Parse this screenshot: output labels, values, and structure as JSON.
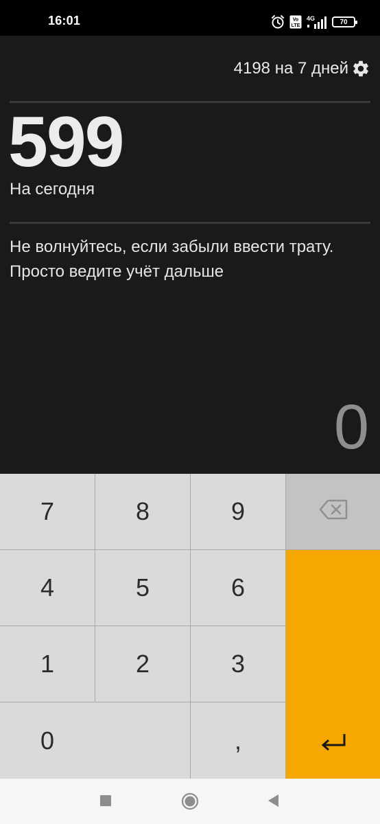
{
  "status_bar": {
    "time": "16:01",
    "icons": [
      "alarm-icon",
      "volte-icon",
      "signal-4g-icon",
      "battery-icon"
    ],
    "volte_label": "Vo LTE",
    "network_label": "4G",
    "battery_level": "70"
  },
  "header": {
    "budget_text": "4198 на 7 дней",
    "settings_icon": "gear-icon"
  },
  "today": {
    "amount": "599",
    "label": "На сегодня"
  },
  "hint": "Не волнуйтесь, если забыли ввести трату. Просто ведите учёт дальше",
  "entry": {
    "value": "0"
  },
  "keypad": {
    "k7": "7",
    "k8": "8",
    "k9": "9",
    "k4": "4",
    "k5": "5",
    "k6": "6",
    "k1": "1",
    "k2": "2",
    "k3": "3",
    "k0": "0",
    "comma": ",",
    "backspace_icon": "backspace-icon",
    "enter_icon": "enter-return-icon"
  },
  "colors": {
    "background": "#1a1a1b",
    "key": "#dadadb",
    "backspace_key": "#c3c3c4",
    "enter_key": "#f6a800",
    "entry_text": "#8e8e8e"
  },
  "nav_bar": {
    "buttons": [
      "recents-square-icon",
      "home-circle-icon",
      "back-triangle-icon"
    ]
  }
}
